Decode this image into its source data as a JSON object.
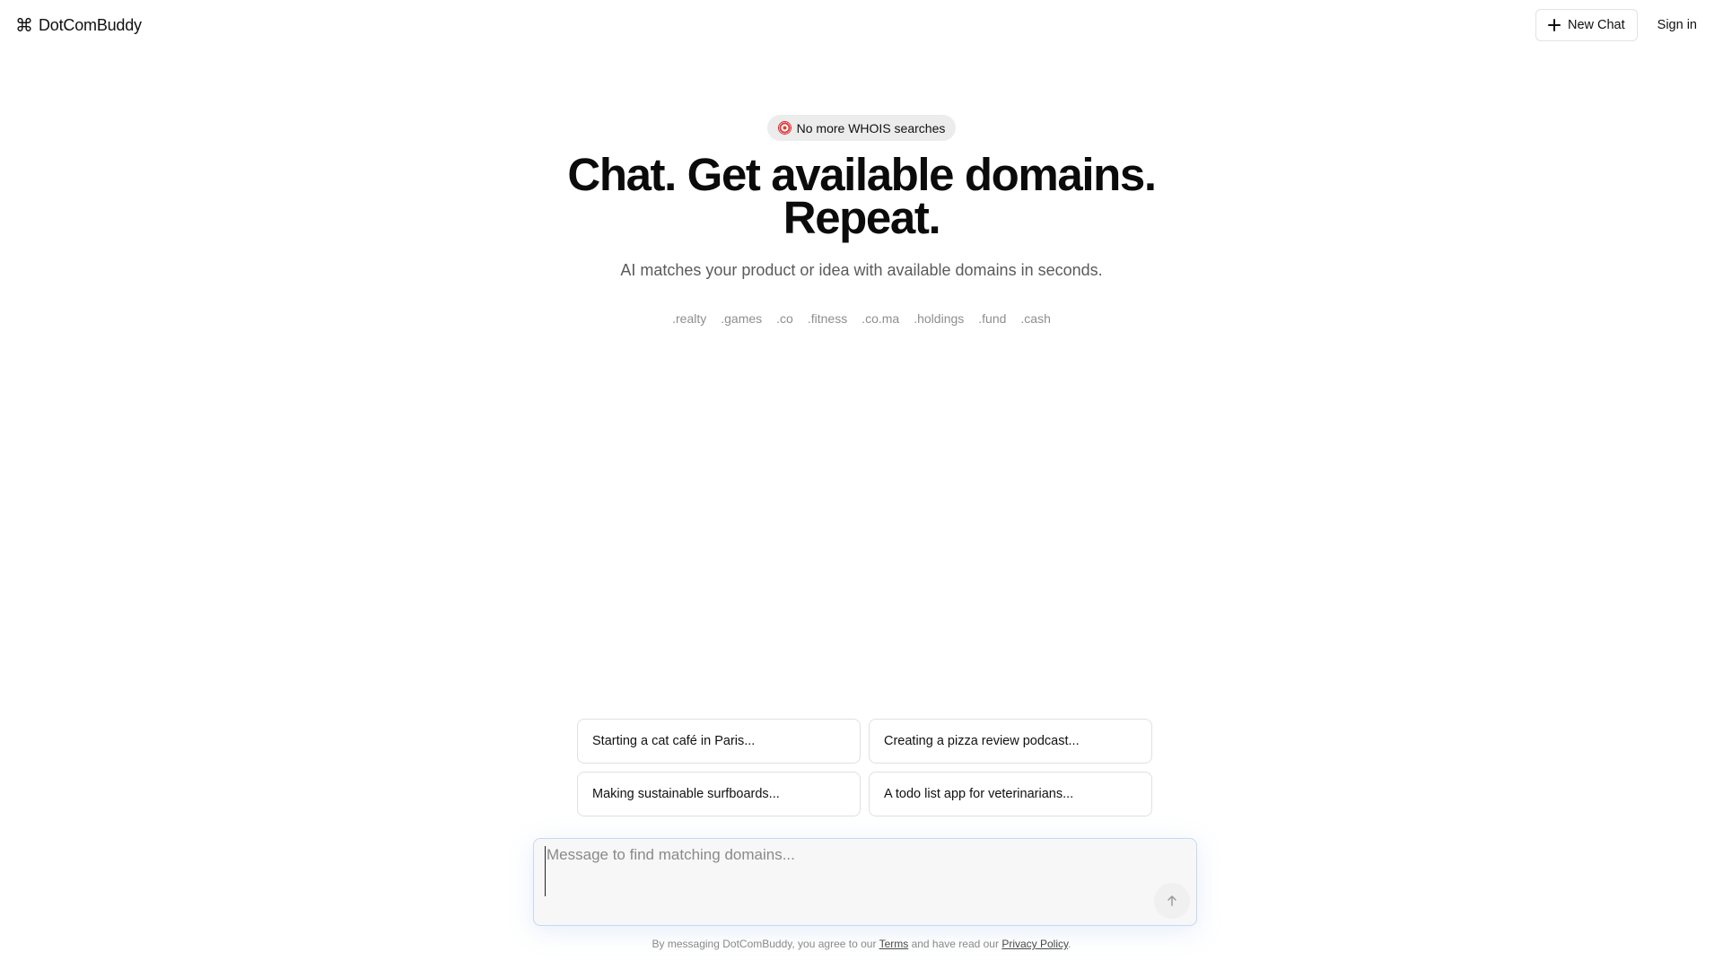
{
  "header": {
    "brand_icon": "⌘",
    "brand_name": "DotComBuddy",
    "new_chat_label": "New Chat",
    "sign_in_label": "Sign in"
  },
  "hero": {
    "badge_icon": "target-icon",
    "badge_text": "No more WHOIS searches",
    "title_line1": "Chat. Get available domains.",
    "title_line2": "Repeat.",
    "subtitle": "AI matches your product or idea with available domains in seconds.",
    "tlds": [
      ".realty",
      ".games",
      ".co",
      ".fitness",
      ".co.ma",
      ".holdings",
      ".fund",
      ".cash"
    ]
  },
  "suggestions": [
    "Starting a cat café in Paris...",
    "Creating a pizza review podcast...",
    "Making sustainable surfboards...",
    "A todo list app for veterinarians..."
  ],
  "composer": {
    "placeholder": "Message to find matching domains...",
    "send_icon": "arrow-up-icon"
  },
  "footer": {
    "prefix": "By messaging DotComBuddy, you agree to our ",
    "terms_label": "Terms",
    "middle": " and have read our ",
    "privacy_label": "Privacy Policy",
    "suffix": "."
  },
  "colors": {
    "badge_bg": "#ececec",
    "composer_border": "#c7d8f4",
    "muted_text": "#8e8e8e"
  }
}
